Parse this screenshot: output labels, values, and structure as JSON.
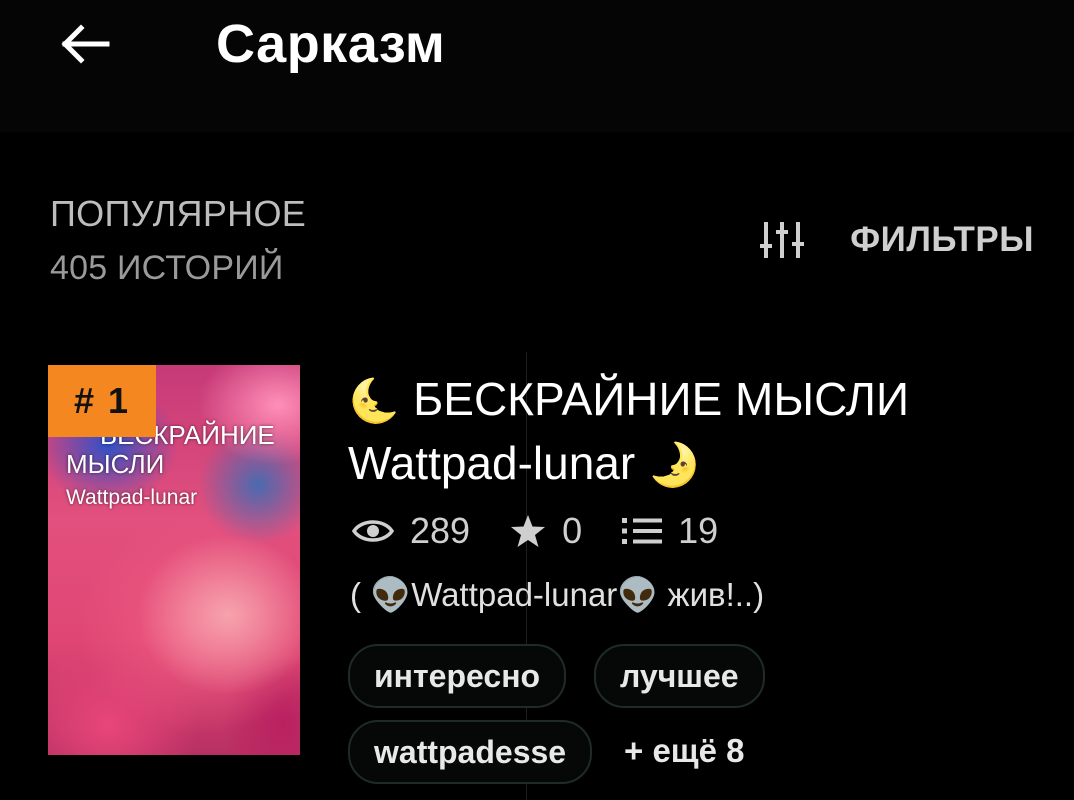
{
  "header": {
    "title": "Сарказм",
    "back_icon": "arrow-left-icon"
  },
  "section": {
    "name": "ПОПУЛЯРНОЕ",
    "count": "405 ИСТОРИЙ"
  },
  "filters": {
    "label": "ФИЛЬТРЫ",
    "icon": "sliders-icon"
  },
  "story": {
    "rank": "# 1",
    "cover": {
      "line1": "БЕСКРАЙНИЕ",
      "line2": "МЫСЛИ",
      "line3": "Wattpad-lunar"
    },
    "title_emoji_start": "🌜",
    "title_text_1": " БЕСКРАЙНИЕ МЫСЛИ",
    "title_text_2": "Wattpad-lunar ",
    "title_emoji_end": "🌛",
    "reads": "289",
    "votes": "0",
    "parts": "19",
    "description": "( 👽Wattpad-lunar👽 жив!..)",
    "tags": [
      "интересно",
      "лучшее",
      "wattpadesse"
    ],
    "more_tags": "+ ещё 8"
  },
  "colors": {
    "background": "#000000",
    "rank_badge": "#f4871f",
    "tag_border": "#1e2b26"
  }
}
